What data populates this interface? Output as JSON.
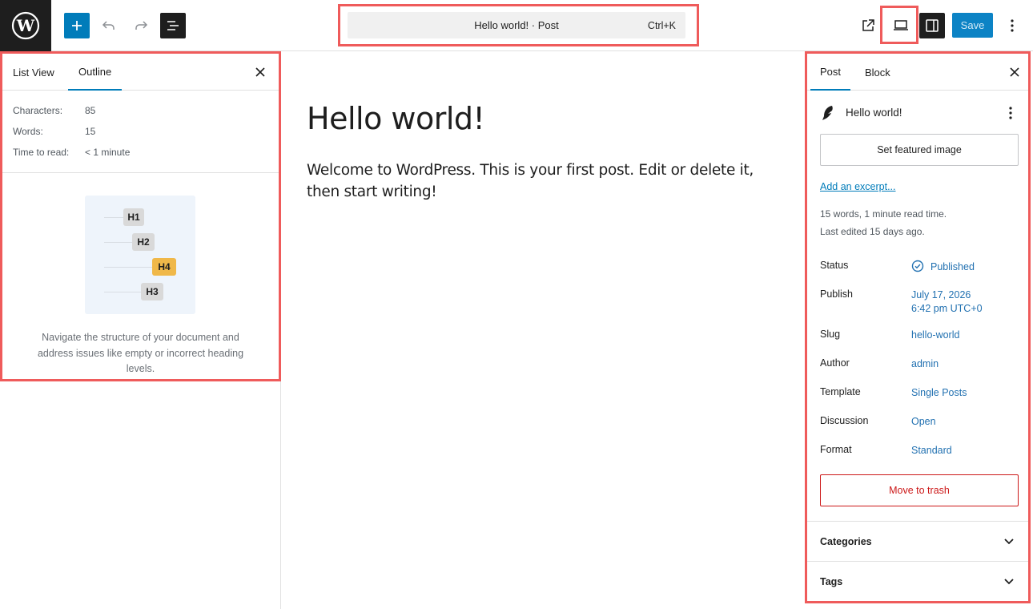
{
  "topbar": {
    "command_title": "Hello world! · Post",
    "command_shortcut": "Ctrl+K",
    "save_label": "Save"
  },
  "left_panel": {
    "tabs": [
      {
        "label": "List View",
        "active": false
      },
      {
        "label": "Outline",
        "active": true
      }
    ],
    "stats": [
      {
        "label": "Characters:",
        "value": "85"
      },
      {
        "label": "Words:",
        "value": "15"
      },
      {
        "label": "Time to read:",
        "value": "< 1 minute"
      }
    ],
    "outline_chips": [
      {
        "label": "H1",
        "warning": false
      },
      {
        "label": "H2",
        "warning": false
      },
      {
        "label": "H4",
        "warning": true
      },
      {
        "label": "H3",
        "warning": false
      }
    ],
    "description": "Navigate the structure of your document and address issues like empty or incorrect heading levels."
  },
  "editor": {
    "title": "Hello world!",
    "body": "Welcome to WordPress. This is your first post. Edit or delete it, then start writing!"
  },
  "sidebar": {
    "tabs": [
      {
        "label": "Post",
        "active": true
      },
      {
        "label": "Block",
        "active": false
      }
    ],
    "post_title": "Hello world!",
    "featured_image_label": "Set featured image",
    "excerpt_link": "Add an excerpt...",
    "meta": {
      "reading": "15 words, 1 minute read time.",
      "edited": "Last edited 15 days ago."
    },
    "properties": [
      {
        "label": "Status",
        "value": "Published"
      },
      {
        "label": "Publish",
        "value": "July 17, 2026",
        "value2": "6:42 pm UTC+0"
      },
      {
        "label": "Slug",
        "value": "hello-world"
      },
      {
        "label": "Author",
        "value": "admin"
      },
      {
        "label": "Template",
        "value": "Single Posts"
      },
      {
        "label": "Discussion",
        "value": "Open"
      },
      {
        "label": "Format",
        "value": "Standard"
      }
    ],
    "trash_label": "Move to trash",
    "sections": [
      {
        "label": "Categories"
      },
      {
        "label": "Tags"
      }
    ]
  },
  "colors": {
    "accent": "#007cba",
    "highlight_frame": "#ef5b5b",
    "danger": "#cc1818",
    "warning_chip": "#f0b849"
  }
}
